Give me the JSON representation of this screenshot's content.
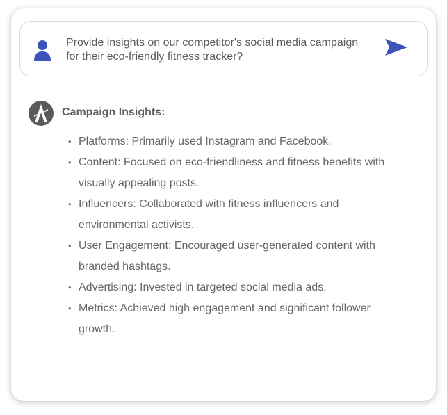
{
  "prompt": {
    "text": "Provide insights on our competitor's social media campaign for their eco-friendly fitness tracker?"
  },
  "response": {
    "heading": "Campaign Insights:",
    "items": [
      "Platforms: Primarily used Instagram and Facebook.",
      "Content: Focused on eco-friendliness and fitness benefits with visually appealing posts.",
      "Influencers: Collaborated with fitness influencers and environmental activists.",
      "User Engagement: Encouraged user-generated content with branded hashtags.",
      "Advertising: Invested in targeted social media ads.",
      "Metrics: Achieved high engagement and significant follower growth."
    ]
  },
  "icons": {
    "user": "user-icon",
    "send": "send-icon",
    "assistant": "assistant-logo-icon"
  },
  "colors": {
    "accent": "#3a54b8",
    "text": "#666666",
    "avatar": "#5b5b5b"
  }
}
